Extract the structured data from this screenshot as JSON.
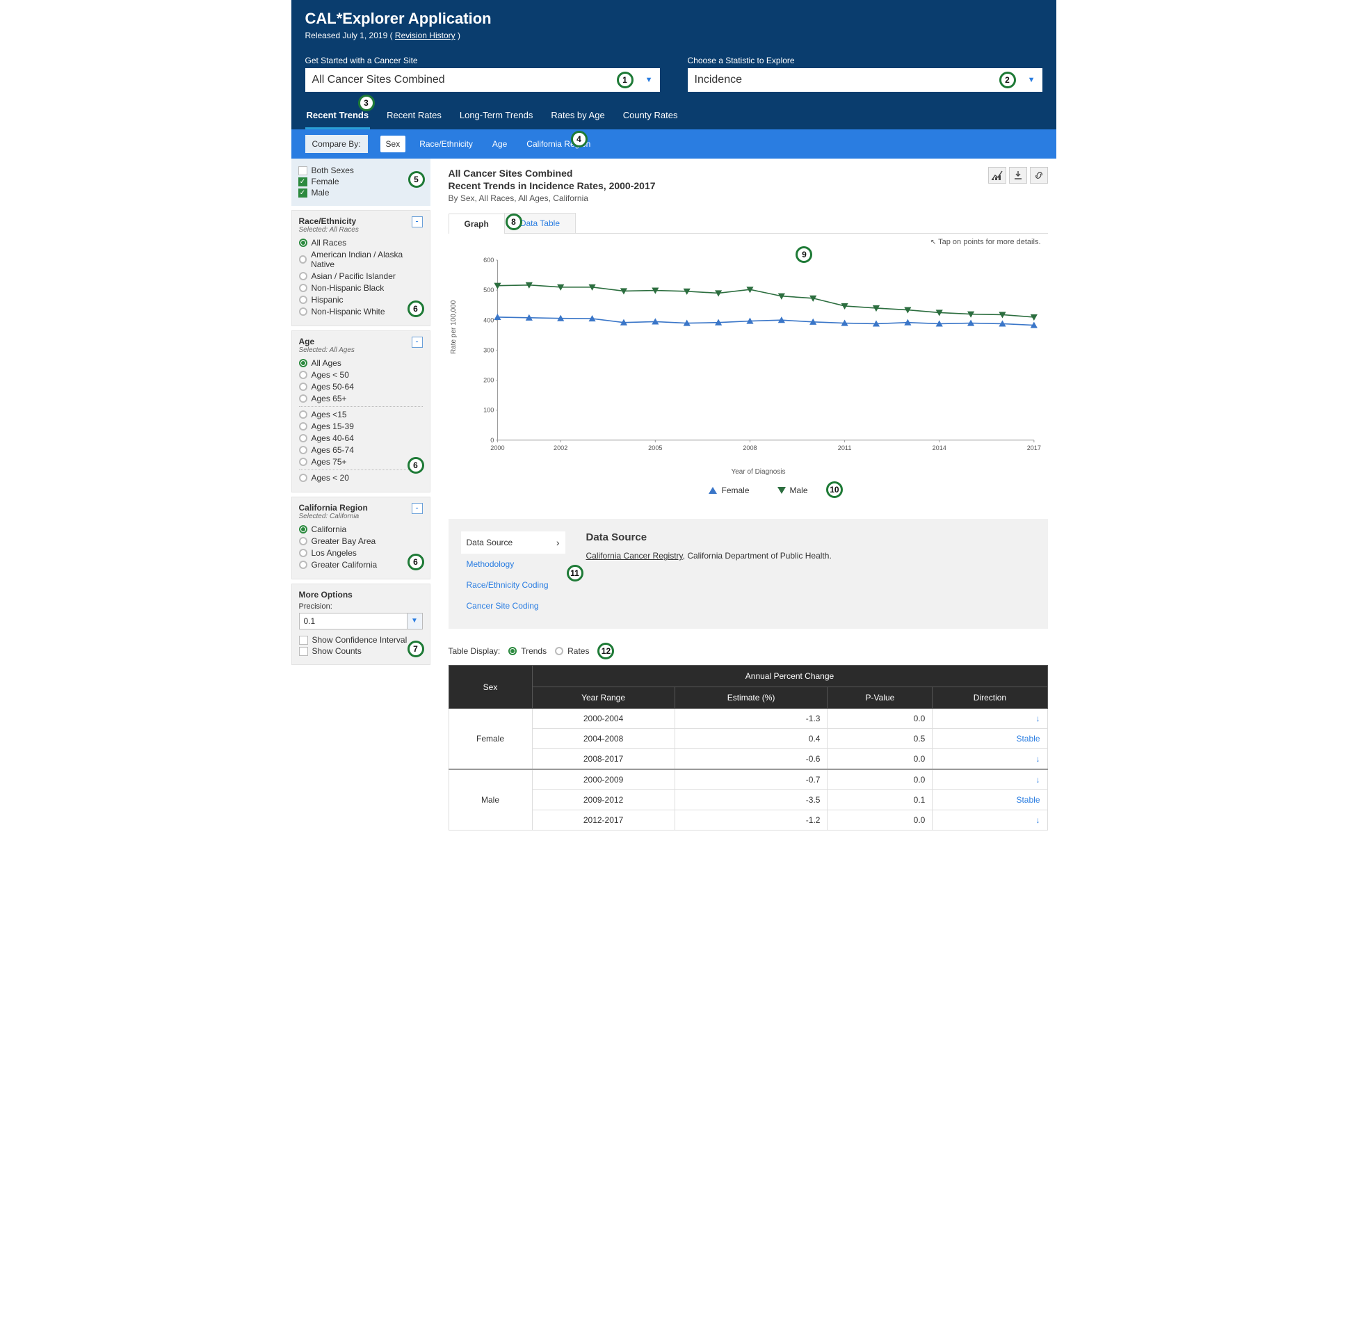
{
  "header": {
    "app_title": "CAL*Explorer Application",
    "released_prefix": "Released July 1, 2019 ( ",
    "revision_link": "Revision History",
    "released_suffix": " )"
  },
  "selectors": {
    "site_label": "Get Started with a Cancer Site",
    "site_value": "All Cancer Sites Combined",
    "stat_label": "Choose a Statistic to Explore",
    "stat_value": "Incidence"
  },
  "tabs1": [
    "Recent Trends",
    "Recent Rates",
    "Long-Term Trends",
    "Rates by Age",
    "County Rates"
  ],
  "tabs1_active": 0,
  "compare_label": "Compare By:",
  "compare_tabs": [
    "Sex",
    "Race/Ethnicity",
    "Age",
    "California Region"
  ],
  "compare_active": 0,
  "sex_checks": [
    {
      "label": "Both Sexes",
      "checked": false
    },
    {
      "label": "Female",
      "checked": true
    },
    {
      "label": "Male",
      "checked": true
    }
  ],
  "filter_race": {
    "title": "Race/Ethnicity",
    "sub": "Selected: All Races",
    "selected_index": 0,
    "options": [
      "All Races",
      "American Indian / Alaska Native",
      "Asian / Pacific Islander",
      "Non-Hispanic Black",
      "Hispanic",
      "Non-Hispanic White"
    ]
  },
  "filter_age": {
    "title": "Age",
    "sub": "Selected: All Ages",
    "selected_index": 0,
    "groups": [
      [
        "All Ages",
        "Ages < 50",
        "Ages 50-64",
        "Ages 65+"
      ],
      [
        "Ages <15",
        "Ages 15-39",
        "Ages 40-64",
        "Ages 65-74",
        "Ages 75+"
      ],
      [
        "Ages < 20"
      ]
    ]
  },
  "filter_region": {
    "title": "California Region",
    "sub": "Selected: California",
    "selected_index": 0,
    "options": [
      "California",
      "Greater Bay Area",
      "Los Angeles",
      "Greater California"
    ]
  },
  "more_options": {
    "title": "More Options",
    "precision_label": "Precision:",
    "precision_value": "0.1",
    "show_ci": "Show Confidence Interval",
    "show_counts": "Show Counts"
  },
  "main_title": {
    "line1": "All Cancer Sites Combined",
    "line2": "Recent Trends in Incidence Rates, 2000-2017",
    "sub": "By Sex, All Races, All Ages, California"
  },
  "view_tabs": [
    "Graph",
    "Data Table"
  ],
  "view_active": 0,
  "tap_hint": "Tap on points for more details.",
  "axis_y": "Rate per 100,000",
  "axis_x": "Year of Diagnosis",
  "legend": {
    "female": "Female",
    "male": "Male"
  },
  "info": {
    "nav": [
      "Data Source",
      "Methodology",
      "Race/Ethnicity Coding",
      "Cancer Site Coding"
    ],
    "heading": "Data Source",
    "link": "California Cancer Registry",
    "rest": ", California Department of Public Health."
  },
  "table": {
    "display_label": "Table Display:",
    "opt_trends": "Trends",
    "opt_rates": "Rates",
    "h_sex": "Sex",
    "h_apc": "Annual Percent Change",
    "h_range": "Year Range",
    "h_est": "Estimate (%)",
    "h_p": "P-Value",
    "h_dir": "Direction",
    "groups": [
      {
        "sex": "Female",
        "rows": [
          {
            "range": "2000-2004",
            "est": "-1.3",
            "p": "0.0",
            "dir": "↓"
          },
          {
            "range": "2004-2008",
            "est": "0.4",
            "p": "0.5",
            "dir": "Stable"
          },
          {
            "range": "2008-2017",
            "est": "-0.6",
            "p": "0.0",
            "dir": "↓"
          }
        ]
      },
      {
        "sex": "Male",
        "rows": [
          {
            "range": "2000-2009",
            "est": "-0.7",
            "p": "0.0",
            "dir": "↓"
          },
          {
            "range": "2009-2012",
            "est": "-3.5",
            "p": "0.1",
            "dir": "Stable"
          },
          {
            "range": "2012-2017",
            "est": "-1.2",
            "p": "0.0",
            "dir": "↓"
          }
        ]
      }
    ]
  },
  "chart_data": {
    "type": "line",
    "xlabel": "Year of Diagnosis",
    "ylabel": "Rate per 100,000",
    "ylim": [
      0,
      600
    ],
    "yticks": [
      0,
      100,
      200,
      300,
      400,
      500,
      600
    ],
    "xticks": [
      2000,
      2002,
      2005,
      2008,
      2011,
      2014,
      2017
    ],
    "x": [
      2000,
      2001,
      2002,
      2003,
      2004,
      2005,
      2006,
      2007,
      2008,
      2009,
      2010,
      2011,
      2012,
      2013,
      2014,
      2015,
      2016,
      2017
    ],
    "series": [
      {
        "name": "Female",
        "color": "#3a76c8",
        "marker": "triangle-up",
        "values": [
          410,
          408,
          406,
          405,
          392,
          395,
          390,
          392,
          397,
          400,
          394,
          390,
          388,
          392,
          388,
          390,
          388,
          383
        ]
      },
      {
        "name": "Male",
        "color": "#2c6e3f",
        "marker": "triangle-down",
        "values": [
          515,
          517,
          510,
          510,
          497,
          499,
          496,
          490,
          502,
          480,
          473,
          447,
          440,
          434,
          425,
          420,
          418,
          410
        ]
      }
    ]
  },
  "badges": [
    "1",
    "2",
    "3",
    "4",
    "5",
    "6",
    "6",
    "6",
    "7",
    "8",
    "9",
    "10",
    "11",
    "12"
  ]
}
